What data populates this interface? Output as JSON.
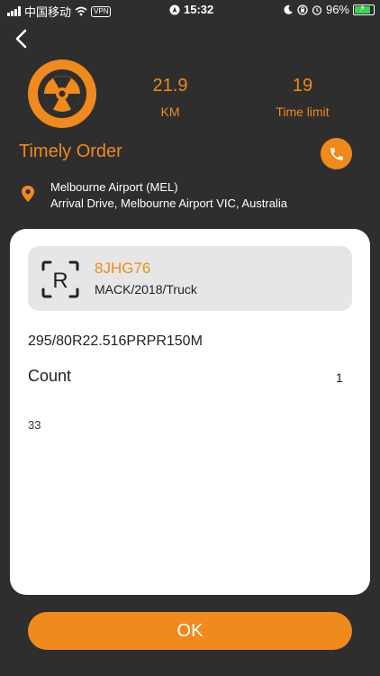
{
  "status_bar": {
    "carrier": "中国移动",
    "vpn": "VPN",
    "time": "15:32",
    "battery": "96%",
    "battery_level": 0.96
  },
  "nav": {
    "back_icon": "chevron-left-icon"
  },
  "stats": {
    "distance_value": "21.9",
    "distance_unit": "KM",
    "time_value": "19",
    "time_label": "Time limit"
  },
  "order": {
    "title": "Timely Order",
    "call_icon": "phone-icon",
    "location_name": "Melbourne Airport (MEL)",
    "location_address": "Arrival Drive, Melbourne Airport VIC, Australia"
  },
  "vehicle": {
    "plate": "8JHG76",
    "info": "MACK/2018/Truck",
    "plate_icon_letter": "R"
  },
  "details": {
    "tire_spec": "295/80R22.516PRPR150M",
    "count_label": "Count",
    "count_value": "1",
    "extra_value": "33"
  },
  "actions": {
    "ok_label": "OK"
  },
  "colors": {
    "accent": "#f08a1c",
    "background": "#2e2e2e",
    "card": "#ffffff",
    "vehicle_card": "#e6e6e6"
  }
}
